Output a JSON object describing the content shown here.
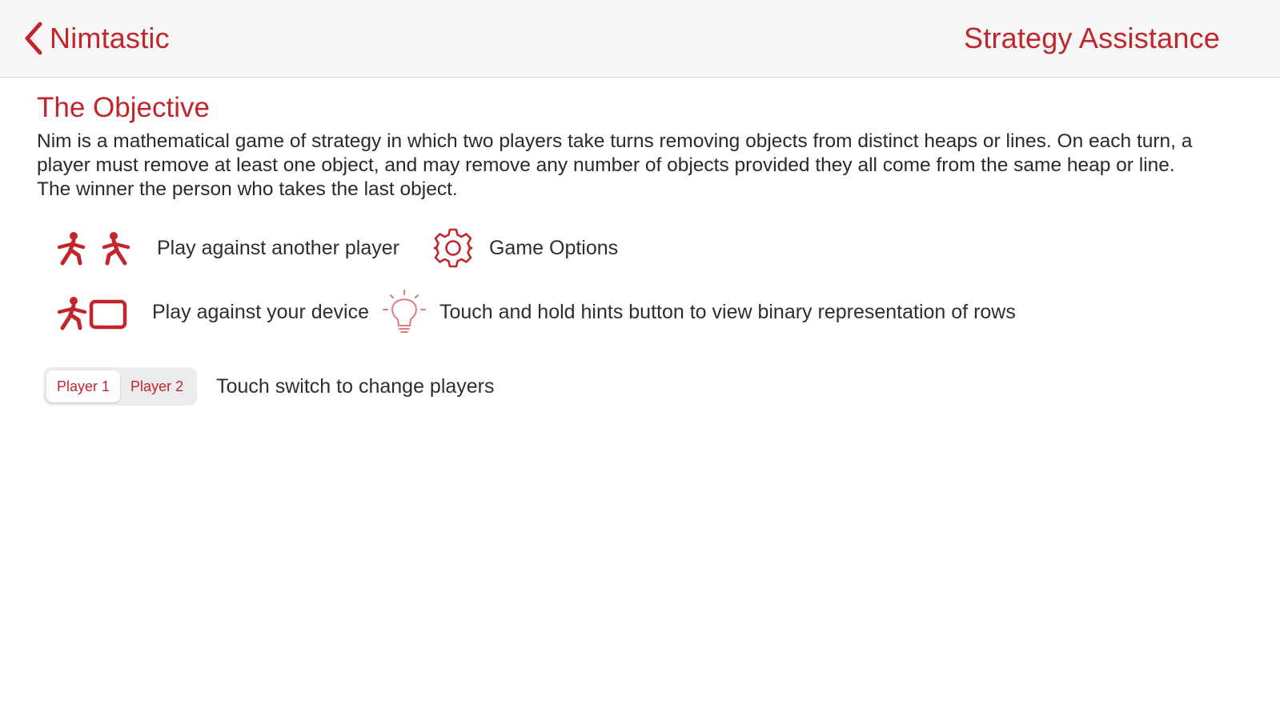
{
  "nav": {
    "back_label": "Nimtastic",
    "title": "Strategy Assistance"
  },
  "objective": {
    "title": "The Objective",
    "text": "Nim is a mathematical game of strategy in which two players take turns removing objects from distinct heaps or lines. On each turn, a player must remove at least one object, and may remove any number of objects provided they all come from the same heap or line.  The winner the person who takes the last object."
  },
  "legend": {
    "two_player_label": "Play against another player",
    "game_options_label": "Game Options",
    "device_label": "Play against your device",
    "hints_label": "Touch and hold hints button to view binary representation of rows"
  },
  "player_switch": {
    "options": [
      "Player 1",
      "Player 2"
    ],
    "selected": "Player 1",
    "label": "Touch switch to change players"
  },
  "icons": {
    "back": "chevron-left-icon",
    "two_player": "two-player-icon",
    "game_options": "gear-icon",
    "device": "player-vs-device-icon",
    "hints": "lightbulb-icon"
  },
  "colors": {
    "accent": "#c0262c",
    "nav_background": "#f7f7f7",
    "text": "#2a2a2a"
  }
}
